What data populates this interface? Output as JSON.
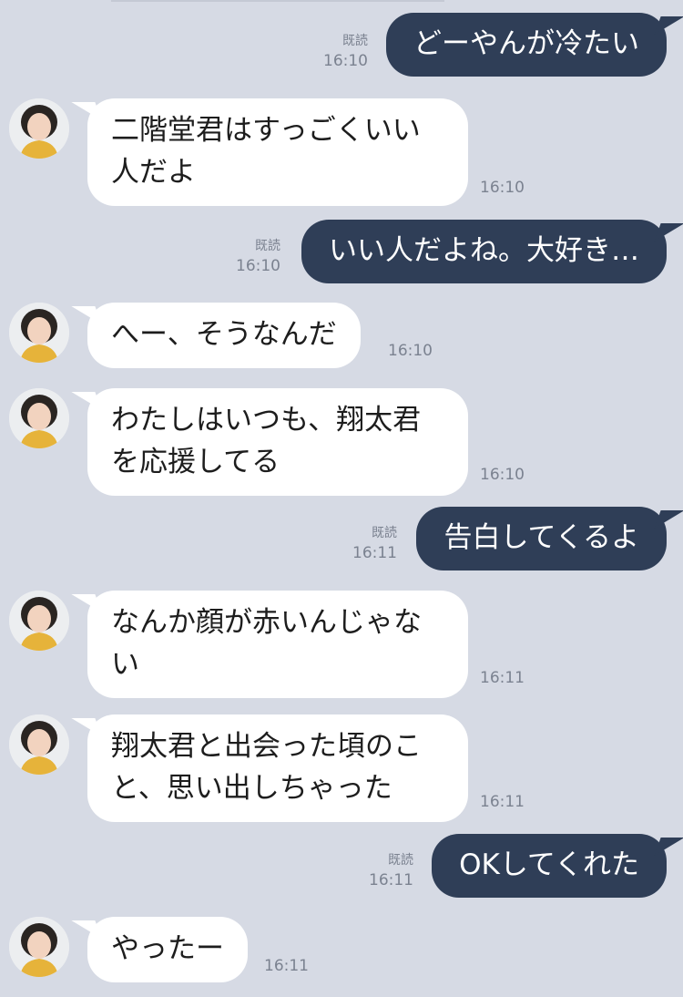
{
  "messages": [
    {
      "id": "m1",
      "side": "out",
      "text": "どーやんが冷たい",
      "read": "既読",
      "time": "16:10"
    },
    {
      "id": "m2",
      "side": "in",
      "lines": [
        "二階堂君はすっごくいい",
        "人だよ"
      ],
      "time": "16:10"
    },
    {
      "id": "m3",
      "side": "out",
      "text": "いい人だよね。大好き…",
      "read": "既読",
      "time": "16:10"
    },
    {
      "id": "m4",
      "side": "in",
      "lines": [
        "へー、そうなんだ"
      ],
      "time": "16:10"
    },
    {
      "id": "m5",
      "side": "in",
      "lines": [
        "わたしはいつも、翔太君",
        "を応援してる"
      ],
      "time": "16:10"
    },
    {
      "id": "m6",
      "side": "out",
      "text": "告白してくるよ",
      "read": "既読",
      "time": "16:11"
    },
    {
      "id": "m7",
      "side": "in",
      "lines": [
        "なんか顔が赤いんじゃな",
        "い"
      ],
      "time": "16:11"
    },
    {
      "id": "m8",
      "side": "in",
      "lines": [
        "翔太君と出会った頃のこ",
        "と、思い出しちゃった"
      ],
      "time": "16:11"
    },
    {
      "id": "m9",
      "side": "out",
      "text": "OKしてくれた",
      "read": "既読",
      "time": "16:11"
    },
    {
      "id": "m10",
      "side": "in",
      "lines": [
        "やったー"
      ],
      "time": "16:11"
    }
  ],
  "colors": {
    "background": "#d6dae4",
    "outgoing_bubble": "#2f3e57",
    "incoming_bubble": "#ffffff",
    "meta_text": "#7b8290"
  },
  "icons": {
    "avatar": "contact-avatar"
  }
}
